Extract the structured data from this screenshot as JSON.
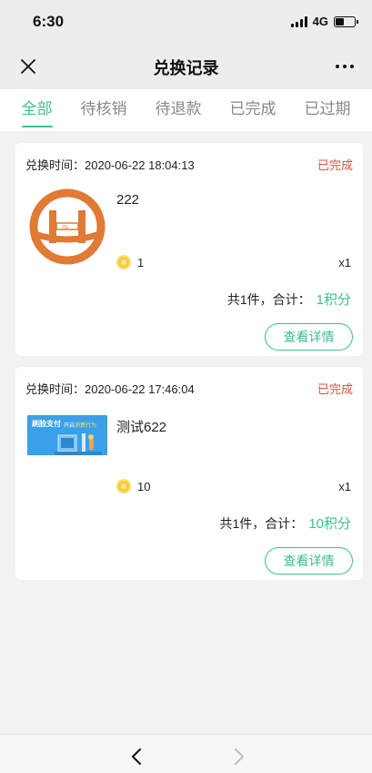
{
  "status_bar": {
    "time": "6:30",
    "network": "4G"
  },
  "nav": {
    "title": "兑换记录"
  },
  "tabs": [
    {
      "label": "全部",
      "active": true
    },
    {
      "label": "待核销",
      "active": false
    },
    {
      "label": "待退款",
      "active": false
    },
    {
      "label": "已完成",
      "active": false
    },
    {
      "label": "已过期",
      "active": false
    }
  ],
  "orders": [
    {
      "time_label": "兑换时间：2020-06-22 18:04:13",
      "status": "已完成",
      "product_name": "222",
      "coin_price": "1",
      "quantity": "x1",
      "summary_prefix": "共1件，合计：",
      "total_points": "1积分",
      "detail_button": "查看详情",
      "thumb_text": "HS"
    },
    {
      "time_label": "兑换时间：2020-06-22 17:46:04",
      "status": "已完成",
      "product_name": "测试622",
      "coin_price": "10",
      "quantity": "x1",
      "summary_prefix": "共1件，合计：",
      "total_points": "10积分",
      "detail_button": "查看详情",
      "thumb_title": "刷脸支付",
      "thumb_sub_prefix": "开启",
      "thumb_sub_highlight": "消费行为"
    }
  ],
  "colors": {
    "accent": "#3cc08e",
    "status_done": "#e0513f",
    "logo_orange": "#e07a35",
    "promo_blue": "#3aa0e8"
  }
}
